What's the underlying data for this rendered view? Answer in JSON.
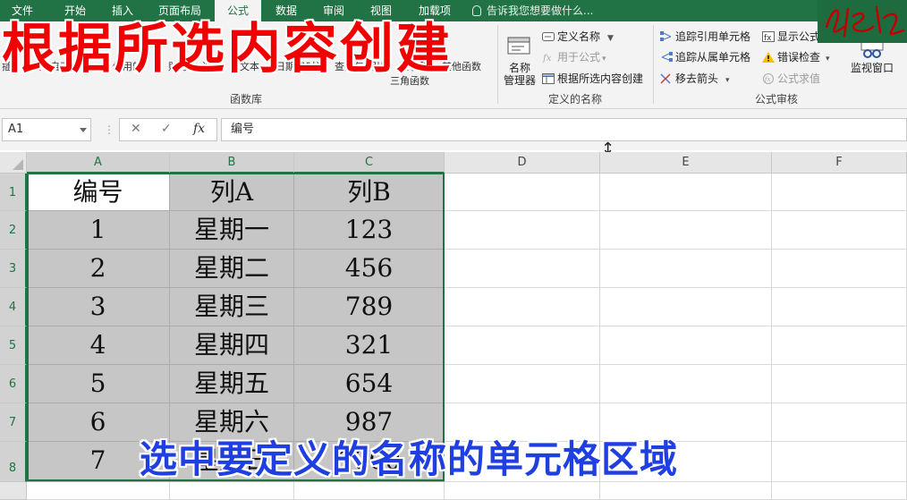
{
  "tabs": [
    "文件",
    "开始",
    "插入",
    "页面布局",
    "公式",
    "数据",
    "审阅",
    "视图",
    "加载项"
  ],
  "active_tab": "公式",
  "tell_me": "告诉我您想要做什么...",
  "ribbon": {
    "function_library": {
      "label": "函数库",
      "faded_items": [
        "插",
        "函数",
        "自动求",
        "使用的",
        "财务",
        "逻辑",
        "文本",
        "日期和",
        "时间",
        "查找与",
        "引用",
        "数学和",
        "三角函数",
        "其他函数"
      ]
    },
    "defined_names": {
      "label": "定义的名称",
      "name_manager": "名称\n管理器",
      "name_manager_l1": "名称",
      "name_manager_l2": "管理器",
      "define_name": "定义名称",
      "use_in_formula": "用于公式",
      "create_from_selection": "根据所选内容创建"
    },
    "formula_auditing": {
      "label": "公式审核",
      "trace_precedents": "追踪引用单元格",
      "trace_dependents": "追踪从属单元格",
      "remove_arrows": "移去箭头",
      "show_formulas": "显示公式",
      "error_checking": "错误检查",
      "evaluate_formula": "公式求值",
      "watch_window": "监视窗口"
    }
  },
  "overlay_title": "根据所选内容创建",
  "caption": "选中要定义的名称的单元格区域",
  "formula_bar": {
    "name_box": "A1",
    "formula": "编号"
  },
  "columns": [
    "A",
    "B",
    "C",
    "D",
    "E",
    "F"
  ],
  "rows": [
    "1",
    "2",
    "3",
    "4",
    "5",
    "6",
    "7",
    "8"
  ],
  "cells": [
    [
      "编号",
      "列A",
      "列B"
    ],
    [
      "1",
      "星期一",
      "123"
    ],
    [
      "2",
      "星期二",
      "456"
    ],
    [
      "3",
      "星期三",
      "789"
    ],
    [
      "4",
      "星期四",
      "321"
    ],
    [
      "5",
      "星期五",
      "654"
    ],
    [
      "6",
      "星期六",
      "987"
    ],
    [
      "7",
      "星期日",
      "1000"
    ]
  ],
  "colors": {
    "excel_green": "#217346",
    "title_red": "#f00000",
    "caption_blue": "#1f3fe0",
    "selection_gray": "#c6c6c6"
  }
}
